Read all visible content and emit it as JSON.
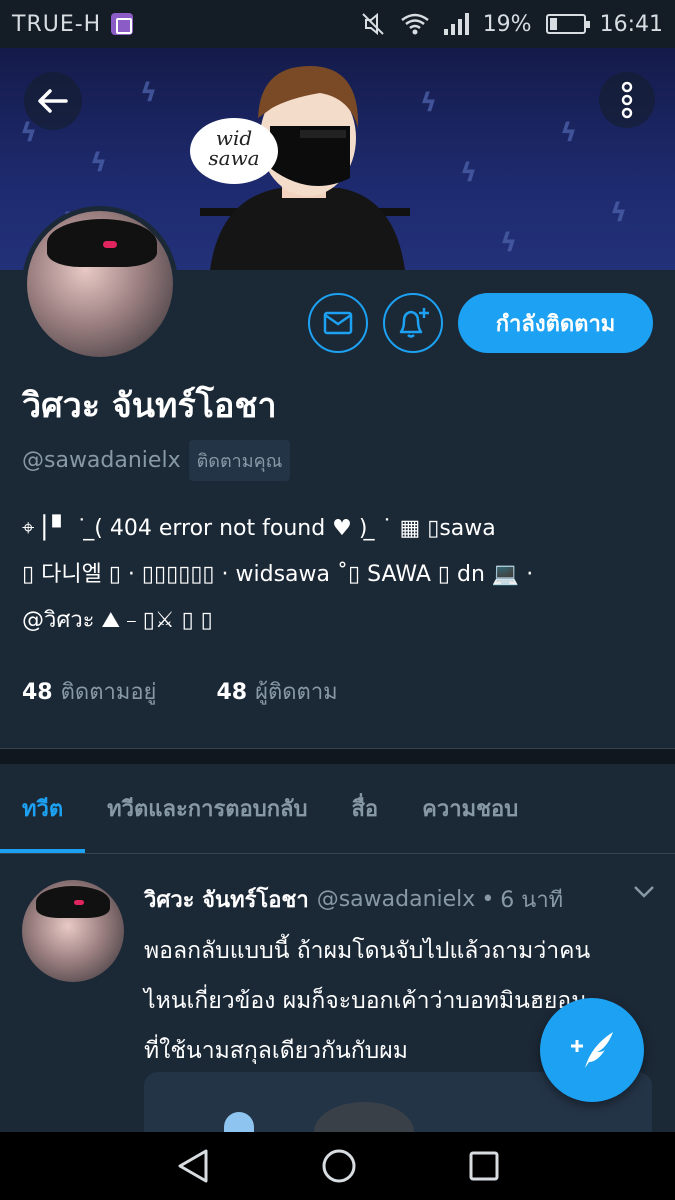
{
  "status_bar": {
    "carrier": "TRUE-H",
    "battery": "19%",
    "time": "16:41"
  },
  "banner": {
    "speech_text_line1": "wid",
    "speech_text_line2": "sawa"
  },
  "profile": {
    "display_name": "วิศวะ จันทร์โอชา",
    "handle": "@sawadanielx",
    "follows_you": "ติดตามคุณ",
    "follow_button": "กำลังติดตาม",
    "bio_line1": "⌖ ⎢▘ ˙ ̲( 404 error not found ♥ ) ̲ ˙ ▦  ▯sawa",
    "bio_line2": "▯ 다니엘 ▯ · ▯▯▯▯▯▯ · widsawa ˚▯ SAWA ▯ dn 💻  ·",
    "bio_line3": "@วิศวะ ⛰   ⎯  ▯⚔  ▯ ▯",
    "following_count": "48",
    "following_label": "ติดตามอยู่",
    "followers_count": "48",
    "followers_label": "ผู้ติดตาม"
  },
  "tabs": [
    {
      "label": "ทวีต",
      "active": true
    },
    {
      "label": "ทวีตและการตอบกลับ",
      "active": false
    },
    {
      "label": "สื่อ",
      "active": false
    },
    {
      "label": "ความชอบ",
      "active": false
    }
  ],
  "tweet": {
    "name": "วิศวะ จันทร์โอชา",
    "handle": "@sawadanielx",
    "dot": "•",
    "time": "6 นาที",
    "text_line1": "พอลกลับแบบนี้ ถ้าผมโดนจับไปแล้วถามว่าคน",
    "text_line2": "ไหนเกี่ยวข้อง ผมก็จะบอกเค้าว่าบอทมินฮยอน",
    "text_line3": "ที่ใช้นามสกุลเดียวกันกับผม"
  },
  "colors": {
    "accent": "#1da1f2",
    "background": "#1b2836",
    "secondary_text": "#8899a6"
  }
}
